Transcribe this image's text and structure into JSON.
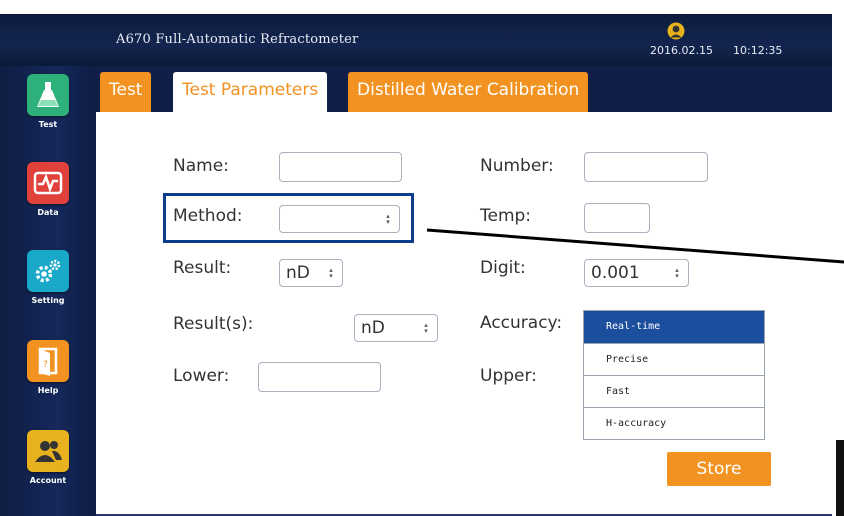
{
  "window": {
    "title": "A670 Full-Automatic Refractometer",
    "date": "2016.02.15",
    "time": "10:12:35"
  },
  "sidebar": {
    "items": [
      {
        "label": "Test",
        "icon": "flask-icon",
        "color": "#2eb07a"
      },
      {
        "label": "Data",
        "icon": "chart-icon",
        "color": "#e0413a"
      },
      {
        "label": "Setting",
        "icon": "gears-icon",
        "color": "#1aa8c9"
      },
      {
        "label": "Help",
        "icon": "door-icon",
        "color": "#f29221"
      },
      {
        "label": "Account",
        "icon": "users-icon",
        "color": "#e8b21f"
      }
    ]
  },
  "tabs": [
    {
      "label": "Test"
    },
    {
      "label": "Test Parameters"
    },
    {
      "label": "Distilled Water Calibration"
    }
  ],
  "form": {
    "name_label": "Name:",
    "name_value": "",
    "number_label": "Number:",
    "number_value": "",
    "method_label": "Method:",
    "method_value": "",
    "temp_label": "Temp:",
    "temp_value": "",
    "result_label": "Result:",
    "result_value": "nD",
    "digit_label": "Digit:",
    "digit_value": "0.001",
    "results_label": "Result(s):",
    "results_value": "nD",
    "accuracy_label": "Accuracy:",
    "accuracy_options": [
      "Real-time",
      "Precise",
      "Fast",
      "H-accuracy"
    ],
    "accuracy_selected": "Real-time",
    "lower_label": "Lower:",
    "lower_value": "",
    "upper_label": "Upper:",
    "store_label": "Store"
  },
  "colors": {
    "accent": "#f29221",
    "nav_bg": "#0f1f47",
    "highlight_box": "#0b3d8c",
    "selected_option": "#1c4e9e"
  }
}
